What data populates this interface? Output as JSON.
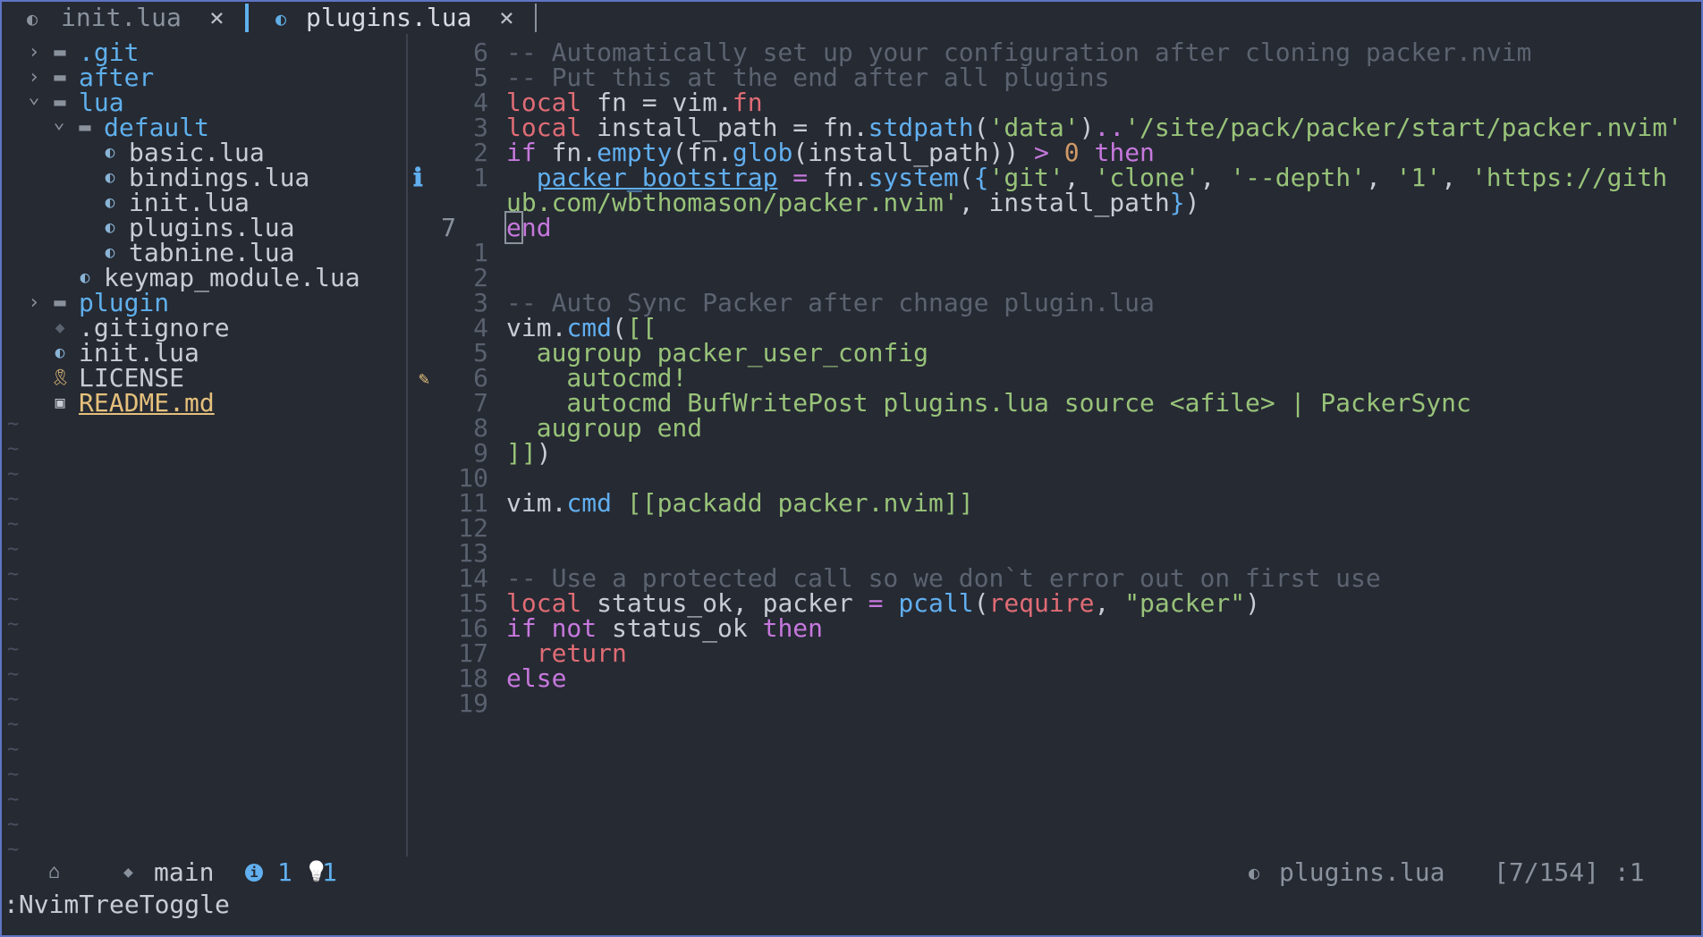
{
  "tabs": [
    {
      "icon": "lua-file-icon",
      "name": "init.lua",
      "close": "×",
      "active": false
    },
    {
      "icon": "lua-file-icon",
      "name": "plugins.lua",
      "close": "×",
      "active": true
    }
  ],
  "colors": {
    "accent": "#5f74c4",
    "folder": "#5fb0ec",
    "readme": "#e5c07b",
    "background": "#262a33"
  },
  "tree": [
    {
      "label": ".git",
      "type": "folder",
      "expanded": false,
      "depth": 0
    },
    {
      "label": "after",
      "type": "folder",
      "expanded": false,
      "depth": 0
    },
    {
      "label": "lua",
      "type": "folder",
      "expanded": true,
      "depth": 0
    },
    {
      "label": "default",
      "type": "folder",
      "expanded": true,
      "depth": 1
    },
    {
      "label": "basic.lua",
      "type": "lua",
      "depth": 2
    },
    {
      "label": "bindings.lua",
      "type": "lua",
      "depth": 2
    },
    {
      "label": "init.lua",
      "type": "lua",
      "depth": 2
    },
    {
      "label": "plugins.lua",
      "type": "lua",
      "depth": 2
    },
    {
      "label": "tabnine.lua",
      "type": "lua",
      "depth": 2
    },
    {
      "label": "keymap_module.lua",
      "type": "lua",
      "depth": 1
    },
    {
      "label": "plugin",
      "type": "folder",
      "expanded": false,
      "depth": 0
    },
    {
      "label": ".gitignore",
      "type": "git",
      "depth": 0
    },
    {
      "label": "init.lua",
      "type": "lua",
      "depth": 0
    },
    {
      "label": "LICENSE",
      "type": "license",
      "depth": 0
    },
    {
      "label": "README.md",
      "type": "markdown",
      "depth": 0
    }
  ],
  "empty_line_marker": "~",
  "editor": {
    "line_numbers": [
      "6",
      "5",
      "4",
      "3",
      "2",
      "1",
      "",
      "7",
      "1",
      "2",
      "3",
      "4",
      "5",
      "6",
      "7",
      "8",
      "9",
      "10",
      "11",
      "12",
      "13",
      "14",
      "15",
      "16",
      "17",
      "18",
      "19"
    ],
    "lines": [
      [
        [
          "c-cm",
          "-- Automatically set up your configuration after cloning packer.nvim"
        ]
      ],
      [
        [
          "c-cm",
          "-- Put this at the end after all plugins"
        ]
      ],
      [
        [
          "c-lc",
          "local"
        ],
        [
          "c-df",
          " fn = vim."
        ],
        [
          "c-lc",
          "fn"
        ]
      ],
      [
        [
          "c-lc",
          "local"
        ],
        [
          "c-df",
          " install_path = fn."
        ],
        [
          "c-fn",
          "stdpath"
        ],
        [
          "c-df",
          "("
        ],
        [
          "c-st",
          "'data'"
        ],
        [
          "c-df",
          ")"
        ],
        [
          "c-op",
          ".."
        ],
        [
          "c-st",
          "'/site/pack/packer/start/packer.nvim'"
        ]
      ],
      [
        [
          "c-kw",
          "if"
        ],
        [
          "c-df",
          " fn."
        ],
        [
          "c-fn",
          "empty"
        ],
        [
          "c-df",
          "(fn."
        ],
        [
          "c-fn",
          "glob"
        ],
        [
          "c-df",
          "(install_path)) "
        ],
        [
          "c-op",
          ">"
        ],
        [
          "c-df",
          " "
        ],
        [
          "c-nu",
          "0"
        ],
        [
          "c-df",
          " "
        ],
        [
          "c-kw",
          "then"
        ]
      ],
      [
        [
          "c-df",
          "  "
        ],
        [
          "c-un",
          "packer_bootstrap"
        ],
        [
          "c-df",
          " "
        ],
        [
          "c-op",
          "="
        ],
        [
          "c-df",
          " fn."
        ],
        [
          "c-fn",
          "system"
        ],
        [
          "c-df",
          "("
        ],
        [
          "c-bl",
          "{"
        ],
        [
          "c-st",
          "'git'"
        ],
        [
          "c-df",
          ", "
        ],
        [
          "c-st",
          "'clone'"
        ],
        [
          "c-df",
          ", "
        ],
        [
          "c-st",
          "'--depth'"
        ],
        [
          "c-df",
          ", "
        ],
        [
          "c-st",
          "'1'"
        ],
        [
          "c-df",
          ", "
        ],
        [
          "c-st",
          "'https://gith"
        ]
      ],
      [
        [
          "c-st",
          "ub.com/wbthomason/packer.nvim'"
        ],
        [
          "c-df",
          ", install_path"
        ],
        [
          "c-bl",
          "}"
        ],
        [
          "c-df",
          ")"
        ]
      ],
      [
        [
          "c-kw cursor",
          "e"
        ],
        [
          "c-kw",
          "nd"
        ]
      ],
      [],
      [],
      [
        [
          "c-cm",
          "-- Auto Sync Packer after chnage plugin.lua"
        ]
      ],
      [
        [
          "c-df",
          "vim."
        ],
        [
          "c-fn",
          "cmd"
        ],
        [
          "c-df",
          "("
        ],
        [
          "c-st",
          "[["
        ]
      ],
      [
        [
          "c-st",
          "  augroup packer_user_config"
        ]
      ],
      [
        [
          "c-st",
          "    autocmd!"
        ]
      ],
      [
        [
          "c-st",
          "    autocmd BufWritePost plugins.lua source <afile> | PackerSync"
        ]
      ],
      [
        [
          "c-st",
          "  augroup end"
        ]
      ],
      [
        [
          "c-st",
          "]]"
        ],
        [
          "c-df",
          ")"
        ]
      ],
      [],
      [
        [
          "c-df",
          "vim."
        ],
        [
          "c-fn",
          "cmd"
        ],
        [
          "c-df",
          " "
        ],
        [
          "c-st",
          "[[packadd packer.nvim]]"
        ]
      ],
      [],
      [],
      [
        [
          "c-cm",
          "-- Use a protected call so we don`t error out on first use"
        ]
      ],
      [
        [
          "c-lc",
          "local"
        ],
        [
          "c-df",
          " status_ok, packer "
        ],
        [
          "c-op",
          "="
        ],
        [
          "c-df",
          " "
        ],
        [
          "c-fn",
          "pcall"
        ],
        [
          "c-df",
          "("
        ],
        [
          "c-lc",
          "require"
        ],
        [
          "c-df",
          ", "
        ],
        [
          "c-st",
          "\"packer\""
        ],
        [
          "c-df",
          ")"
        ]
      ],
      [
        [
          "c-kw",
          "if"
        ],
        [
          "c-df",
          " "
        ],
        [
          "c-kw",
          "not"
        ],
        [
          "c-df",
          " status_ok "
        ],
        [
          "c-kw",
          "then"
        ]
      ],
      [
        [
          "c-df",
          "  "
        ],
        [
          "c-lc",
          "return"
        ]
      ],
      [
        [
          "c-kw",
          "else"
        ]
      ],
      []
    ],
    "signs": [
      {
        "line": 5,
        "icon": "info-icon",
        "glyph": "ℹ"
      },
      {
        "line": 13,
        "icon": "lightbulb-icon",
        "glyph": "✎"
      }
    ]
  },
  "status": {
    "home_icon": "⌂",
    "branch_icon": "◆",
    "branch": "main",
    "info_icon": "i",
    "info_count": "1",
    "hint_icon": "💡",
    "hint_count": "1",
    "file_icon": "lua-file-icon",
    "file": "plugins.lua",
    "position": "[7/154] :1"
  },
  "cmdline": ":NvimTreeToggle"
}
